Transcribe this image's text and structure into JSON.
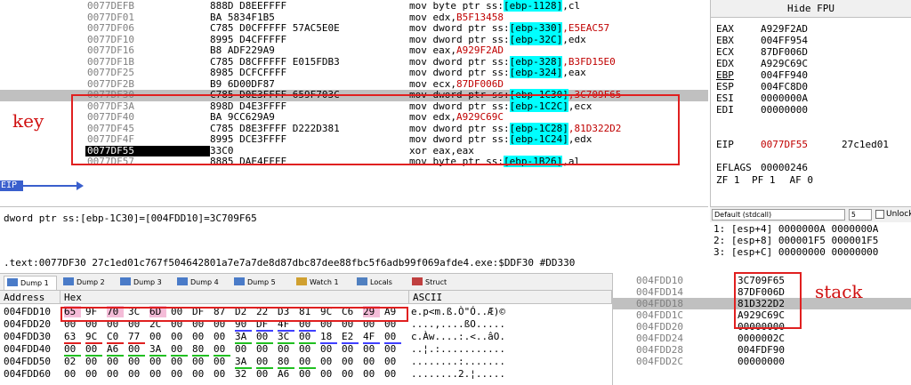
{
  "annotations": {
    "key_label": "key",
    "stack_label": "stack"
  },
  "disasm": {
    "eip_tag": "EIP",
    "rows": [
      {
        "addr": "0077DEFB",
        "bytes": "888D D8EEFFFF",
        "m": "mov byte ptr ss:",
        "r": "[ebp-1128]",
        "t": ",cl",
        "tc": ""
      },
      {
        "addr": "0077DF01",
        "bytes": "BA 5834F1B5",
        "m": "mov edx,",
        "r": "",
        "t": "B5F13458",
        "tc": "red"
      },
      {
        "addr": "0077DF06",
        "bytes": "C785 D0CFFFFF 57AC5E0E",
        "m": "mov dword ptr ss:",
        "r": "[ebp-330]",
        "t": ",E5EAC57",
        "tc": "red"
      },
      {
        "addr": "0077DF10",
        "bytes": "8995 D4CFFFFF",
        "m": "mov dword ptr ss:",
        "r": "[ebp-32C]",
        "t": ",edx",
        "tc": ""
      },
      {
        "addr": "0077DF16",
        "bytes": "B8 ADF229A9",
        "m": "mov eax,",
        "r": "",
        "t": "A929F2AD",
        "tc": "red"
      },
      {
        "addr": "0077DF1B",
        "bytes": "C785 D8CFFFFF E015FDB3",
        "m": "mov dword ptr ss:",
        "r": "[ebp-328]",
        "t": ",B3FD15E0",
        "tc": "red"
      },
      {
        "addr": "0077DF25",
        "bytes": "8985 DCFCFFFF",
        "m": "mov dword ptr ss:",
        "r": "[ebp-324]",
        "t": ",eax",
        "tc": ""
      },
      {
        "addr": "0077DF2B",
        "bytes": "B9 6D00DF87",
        "m": "mov ecx,",
        "r": "",
        "t": "87DF006D",
        "tc": "red"
      },
      {
        "addr": "0077DF30",
        "bytes": "C785 D0E3FFFF 659F703C",
        "m": "mov dword ptr ss:",
        "r": "[ebp-1C30]",
        "t": ",3C709F65",
        "tc": "red"
      },
      {
        "addr": "0077DF3A",
        "bytes": "898D D4E3FFFF",
        "m": "mov dword ptr ss:",
        "r": "[ebp-1C2C]",
        "t": ",ecx",
        "tc": ""
      },
      {
        "addr": "0077DF40",
        "bytes": "BA 9CC629A9",
        "m": "mov edx,",
        "r": "",
        "t": "A929C69C",
        "tc": "red"
      },
      {
        "addr": "0077DF45",
        "bytes": "C785 D8E3FFFF D222D381",
        "m": "mov dword ptr ss:",
        "r": "[ebp-1C28]",
        "t": ",81D322D2",
        "tc": "red"
      },
      {
        "addr": "0077DF4F",
        "bytes": "8995 DCE3FFFF",
        "m": "mov dword ptr ss:",
        "r": "[ebp-1C24]",
        "t": ",edx",
        "tc": ""
      },
      {
        "addr": "0077DF55",
        "bytes": "33C0",
        "m": "xor eax,eax",
        "r": "",
        "t": "",
        "tc": ""
      },
      {
        "addr": "0077DF57",
        "bytes": "8885 DAE4FFFF",
        "m": "mov byte ptr ss:",
        "r": "[ebp-1B26]",
        "t": ",al",
        "tc": ""
      }
    ]
  },
  "registers": {
    "header": "Hide FPU",
    "rows": [
      {
        "name": "EAX",
        "value": "A929F2AD",
        "extra": ""
      },
      {
        "name": "EBX",
        "value": "004FF954",
        "extra": ""
      },
      {
        "name": "ECX",
        "value": "87DF006D",
        "extra": ""
      },
      {
        "name": "EDX",
        "value": "A929C69C",
        "extra": ""
      },
      {
        "name": "EBP",
        "value": "004FF940",
        "extra": ""
      },
      {
        "name": "ESP",
        "value": "004FC8D0",
        "extra": ""
      },
      {
        "name": "ESI",
        "value": "0000000A",
        "extra": ""
      },
      {
        "name": "EDI",
        "value": "00000000",
        "extra": ""
      },
      {
        "name": "EIP",
        "value": "0077DF55",
        "extra": "27c1ed01"
      },
      {
        "name": "EFLAGS",
        "value": "00000246",
        "extra": ""
      },
      {
        "name": "ZF 1",
        "value": "PF 1",
        "extra": "AF 0"
      }
    ]
  },
  "callconv": {
    "selected": "Default (stdcall)",
    "count": "5",
    "unlock": "Unlock"
  },
  "args": [
    {
      "text": "1: [esp+4]  0000000A  0000000A"
    },
    {
      "text": "2: [esp+8]  000001F5  000001F5"
    },
    {
      "text": "3: [esp+C]  00000000  00000000"
    }
  ],
  "info": {
    "line1": "dword ptr ss:[ebp-1C30]=[004FDD10]=3C709F65",
    "line2": ".text:0077DF30 27c1ed01c767f504642801a7e7a7de8d87dbc87dee88fbc5f6adb99f069afde4.exe:$DDF30 #DD330"
  },
  "dump_tabs": [
    "Dump 1",
    "Dump 2",
    "Dump 3",
    "Dump 4",
    "Dump 5",
    "Watch 1",
    "Locals",
    "Struct"
  ],
  "dump": {
    "address_header": "Address",
    "hex_header": "Hex",
    "ascii_header": "ASCII",
    "rows": [
      {
        "addr": "004FDD10",
        "bytes": [
          "65",
          "9F",
          "70",
          "3C",
          "6D",
          "00",
          "DF",
          "87",
          "D2",
          "22",
          "D3",
          "81",
          "9C",
          "C6",
          "29",
          "A9"
        ],
        "ascii": "e.p<m.ß.Ò\"Ó..Æ)©"
      },
      {
        "addr": "004FDD20",
        "bytes": [
          "00",
          "00",
          "00",
          "00",
          "2C",
          "00",
          "00",
          "00",
          "90",
          "DF",
          "4F",
          "00",
          "00",
          "00",
          "00",
          "00"
        ],
        "ascii": "....,....ßO....."
      },
      {
        "addr": "004FDD30",
        "bytes": [
          "63",
          "9C",
          "C0",
          "77",
          "00",
          "00",
          "00",
          "00",
          "3A",
          "00",
          "3C",
          "00",
          "18",
          "E2",
          "4F",
          "00"
        ],
        "ascii": "c.Àw....:.<..âO."
      },
      {
        "addr": "004FDD40",
        "bytes": [
          "00",
          "00",
          "A6",
          "00",
          "3A",
          "00",
          "80",
          "00",
          "00",
          "00",
          "00",
          "00",
          "00",
          "00",
          "00",
          "00"
        ],
        "ascii": "..¦.:..........."
      },
      {
        "addr": "004FDD50",
        "bytes": [
          "02",
          "00",
          "00",
          "00",
          "00",
          "00",
          "00",
          "00",
          "3A",
          "00",
          "80",
          "00",
          "00",
          "00",
          "00",
          "00"
        ],
        "ascii": "........:......."
      },
      {
        "addr": "004FDD60",
        "bytes": [
          "00",
          "00",
          "00",
          "00",
          "00",
          "00",
          "00",
          "00",
          "32",
          "00",
          "A6",
          "00",
          "00",
          "00",
          "00",
          "00"
        ],
        "ascii": "........2.¦....."
      }
    ]
  },
  "stack": [
    {
      "addr": "004FDD10",
      "value": "3C709F65"
    },
    {
      "addr": "004FDD14",
      "value": "87DF006D"
    },
    {
      "addr": "004FDD18",
      "value": "81D322D2"
    },
    {
      "addr": "004FDD1C",
      "value": "A929C69C"
    },
    {
      "addr": "004FDD20",
      "value": "00000000"
    },
    {
      "addr": "004FDD24",
      "value": "0000002C"
    },
    {
      "addr": "004FDD28",
      "value": "004FDF90"
    },
    {
      "addr": "004FDD2C",
      "value": "00000000"
    }
  ],
  "colors": {
    "accent_red": "#e02020",
    "register_highlight": "#00ffff",
    "eip_blue": "#3a5fcd",
    "pink_highlight": "#f4bcd8"
  }
}
